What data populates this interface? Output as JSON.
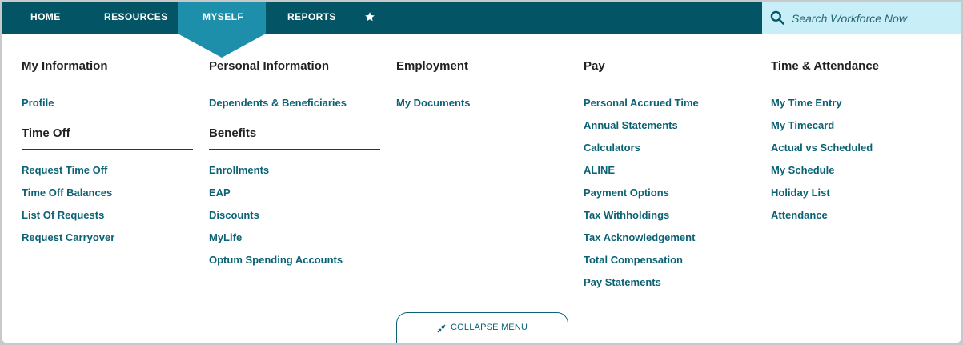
{
  "nav": {
    "items": [
      {
        "label": "HOME"
      },
      {
        "label": "RESOURCES"
      },
      {
        "label": "MYSELF",
        "active": true
      },
      {
        "label": "REPORTS"
      }
    ],
    "favorites_icon": "star-icon"
  },
  "search": {
    "placeholder": "Search Workforce Now",
    "icon": "search-icon"
  },
  "menu": {
    "my_information": {
      "title": "My Information",
      "links": [
        "Profile"
      ]
    },
    "time_off": {
      "title": "Time Off",
      "links": [
        "Request Time Off",
        "Time Off Balances",
        "List Of Requests",
        "Request Carryover"
      ]
    },
    "personal_information": {
      "title": "Personal Information",
      "links": [
        "Dependents & Beneficiaries"
      ]
    },
    "benefits": {
      "title": "Benefits",
      "links": [
        "Enrollments",
        "EAP",
        "Discounts",
        "MyLife",
        "Optum Spending Accounts"
      ]
    },
    "employment": {
      "title": "Employment",
      "links": [
        "My Documents"
      ]
    },
    "pay": {
      "title": "Pay",
      "links": [
        "Personal Accrued Time",
        "Annual Statements",
        "Calculators",
        "ALINE",
        "Payment Options",
        "Tax Withholdings",
        "Tax Acknowledgement",
        "Total Compensation",
        "Pay Statements"
      ]
    },
    "time_attendance": {
      "title": "Time & Attendance",
      "links": [
        "My Time Entry",
        "My Timecard",
        "Actual vs Scheduled",
        "My Schedule",
        "Holiday List",
        "Attendance"
      ]
    }
  },
  "collapse": {
    "label": "COLLAPSE MENU",
    "icon": "collapse-arrows-icon"
  },
  "colors": {
    "nav_bg": "#035565",
    "nav_active": "#1d8faa",
    "search_bg": "#c8eef8",
    "link": "#0b6275"
  }
}
